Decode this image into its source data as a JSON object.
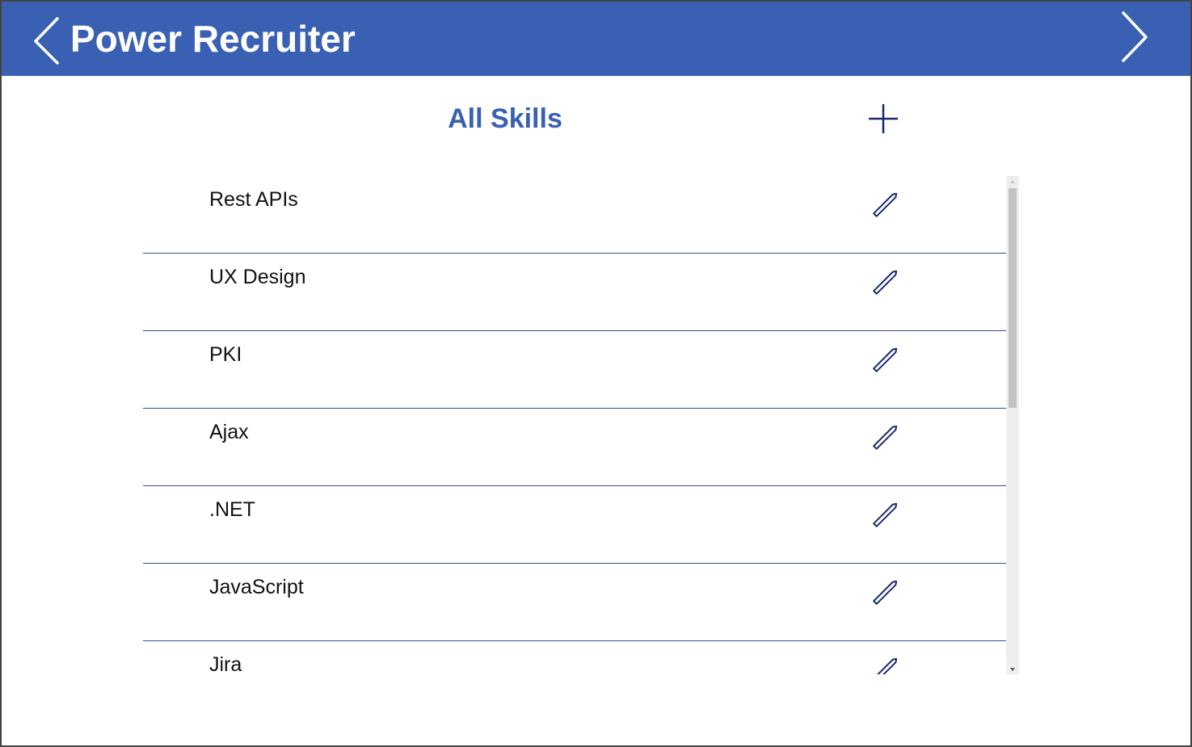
{
  "app": {
    "title": "Power Recruiter",
    "accent_color": "#3960b3",
    "icon_color": "#1b2a6e"
  },
  "header": {
    "back_icon": "chevron-left-icon",
    "forward_icon": "chevron-right-icon"
  },
  "section": {
    "title": "All Skills",
    "add_icon": "plus-icon"
  },
  "skills": [
    {
      "name": "Rest APIs",
      "action_icon": "pencil-icon"
    },
    {
      "name": "UX Design",
      "action_icon": "pencil-icon"
    },
    {
      "name": "PKI",
      "action_icon": "pencil-icon"
    },
    {
      "name": "Ajax",
      "action_icon": "pencil-icon"
    },
    {
      "name": ".NET",
      "action_icon": "pencil-icon"
    },
    {
      "name": "JavaScript",
      "action_icon": "pencil-icon"
    },
    {
      "name": "Jira",
      "action_icon": "pencil-icon"
    }
  ],
  "scrollbar": {
    "scroll_fraction": 0
  }
}
